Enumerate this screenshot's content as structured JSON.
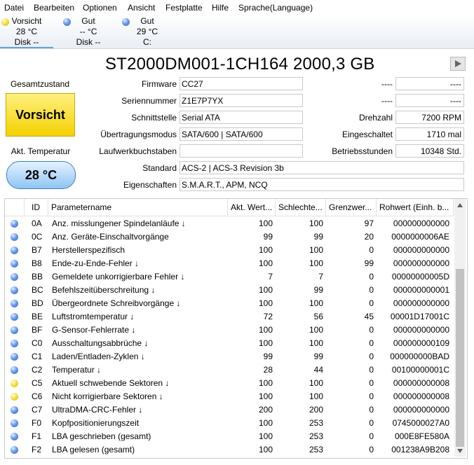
{
  "menu": [
    "Datei",
    "Bearbeiten",
    "Optionen",
    "Ansicht",
    "Festplatte",
    "Hilfe",
    "Sprache(Language)"
  ],
  "disks": [
    {
      "status": "Vorsicht",
      "temp": "28 °C",
      "letter": "Disk --",
      "color": "yellow"
    },
    {
      "status": "Gut",
      "temp": "-- °C",
      "letter": "Disk --",
      "color": "blue"
    },
    {
      "status": "Gut",
      "temp": "29 °C",
      "letter": "C:",
      "color": "blue"
    }
  ],
  "title": "ST2000DM001-1CH164 2000,3 GB",
  "health": {
    "label": "Gesamtzustand",
    "value": "Vorsicht"
  },
  "temperature": {
    "label": "Akt. Temperatur",
    "value": "28 °C"
  },
  "fields": {
    "firmware": {
      "label": "Firmware",
      "value": "CC27"
    },
    "serial": {
      "label": "Seriennummer",
      "value": "Z1E7P7YX"
    },
    "interface": {
      "label": "Schnittstelle",
      "value": "Serial ATA"
    },
    "transfer": {
      "label": "Übertragungsmodus",
      "value": "SATA/600 | SATA/600"
    },
    "drive_letter": {
      "label": "Laufwerkbuchstaben",
      "value": ""
    },
    "standard": {
      "label": "Standard",
      "value": "ACS-2 | ACS-3 Revision 3b"
    },
    "features": {
      "label": "Eigenschaften",
      "value": "S.M.A.R.T., APM, NCQ"
    }
  },
  "right_fields": {
    "r1": {
      "label": "----",
      "value": "----"
    },
    "r2": {
      "label": "----",
      "value": "----"
    },
    "rpm": {
      "label": "Drehzahl",
      "value": "7200 RPM"
    },
    "power_count": {
      "label": "Eingeschaltet",
      "value": "1710 mal"
    },
    "hours": {
      "label": "Betriebsstunden",
      "value": "10348 Std."
    }
  },
  "table": {
    "columns": [
      "ID",
      "Parametername",
      "Akt. Wert...",
      "Schlechte...",
      "Grenzwer...",
      "Rohwert (Einh. b..."
    ],
    "rows": [
      {
        "c": "blue",
        "id": "0A",
        "name": "Anz. misslungener Spindelanläufe ↓",
        "cur": "100",
        "worst": "100",
        "thr": "97",
        "raw": "000000000000"
      },
      {
        "c": "blue",
        "id": "0C",
        "name": "Anz. Geräte-Einschaltvorgänge",
        "cur": "99",
        "worst": "99",
        "thr": "20",
        "raw": "0000000006AE"
      },
      {
        "c": "blue",
        "id": "B7",
        "name": "Herstellerspezifisch",
        "cur": "100",
        "worst": "100",
        "thr": "0",
        "raw": "000000000000"
      },
      {
        "c": "blue",
        "id": "B8",
        "name": "Ende-zu-Ende-Fehler ↓",
        "cur": "100",
        "worst": "100",
        "thr": "99",
        "raw": "000000000000"
      },
      {
        "c": "blue",
        "id": "BB",
        "name": "Gemeldete unkorrigierbare Fehler ↓",
        "cur": "7",
        "worst": "7",
        "thr": "0",
        "raw": "00000000005D"
      },
      {
        "c": "blue",
        "id": "BC",
        "name": "Befehlszeitüberschreitung ↓",
        "cur": "100",
        "worst": "99",
        "thr": "0",
        "raw": "000000000001"
      },
      {
        "c": "blue",
        "id": "BD",
        "name": "Übergeordnete Schreibvorgänge ↓",
        "cur": "100",
        "worst": "100",
        "thr": "0",
        "raw": "000000000000"
      },
      {
        "c": "blue",
        "id": "BE",
        "name": "Luftstromtemperatur ↓",
        "cur": "72",
        "worst": "56",
        "thr": "45",
        "raw": "00001D17001C"
      },
      {
        "c": "blue",
        "id": "BF",
        "name": "G-Sensor-Fehlerrate ↓",
        "cur": "100",
        "worst": "100",
        "thr": "0",
        "raw": "000000000000"
      },
      {
        "c": "blue",
        "id": "C0",
        "name": "Ausschaltungsabbrüche ↓",
        "cur": "100",
        "worst": "100",
        "thr": "0",
        "raw": "000000000109"
      },
      {
        "c": "blue",
        "id": "C1",
        "name": "Laden/Entladen-Zyklen ↓",
        "cur": "99",
        "worst": "99",
        "thr": "0",
        "raw": "000000000BAD"
      },
      {
        "c": "blue",
        "id": "C2",
        "name": "Temperatur ↓",
        "cur": "28",
        "worst": "44",
        "thr": "0",
        "raw": "00100000001C"
      },
      {
        "c": "yellow",
        "id": "C5",
        "name": "Aktuell schwebende Sektoren ↓",
        "cur": "100",
        "worst": "100",
        "thr": "0",
        "raw": "000000000008"
      },
      {
        "c": "yellow",
        "id": "C6",
        "name": "Nicht korrigierbare Sektoren ↓",
        "cur": "100",
        "worst": "100",
        "thr": "0",
        "raw": "000000000008"
      },
      {
        "c": "blue",
        "id": "C7",
        "name": "UltraDMA-CRC-Fehler ↓",
        "cur": "200",
        "worst": "200",
        "thr": "0",
        "raw": "000000000000"
      },
      {
        "c": "blue",
        "id": "F0",
        "name": "Kopfpositionierungszeit",
        "cur": "100",
        "worst": "253",
        "thr": "0",
        "raw": "0745000027A0"
      },
      {
        "c": "blue",
        "id": "F1",
        "name": "LBA geschrieben (gesamt)",
        "cur": "100",
        "worst": "253",
        "thr": "0",
        "raw": "000E8FE580A"
      },
      {
        "c": "blue",
        "id": "F2",
        "name": "LBA gelesen (gesamt)",
        "cur": "100",
        "worst": "253",
        "thr": "0",
        "raw": "001238A9B208"
      }
    ]
  }
}
